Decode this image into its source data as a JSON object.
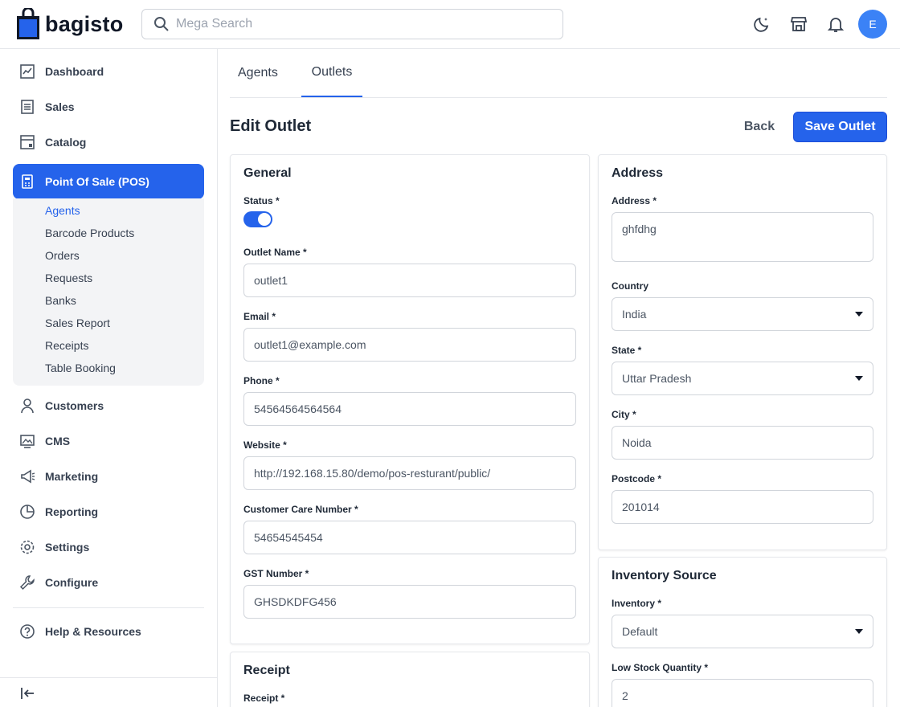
{
  "brand": {
    "name": "bagisto"
  },
  "header": {
    "search_placeholder": "Mega Search",
    "avatar_initial": "E"
  },
  "sidebar": {
    "items": [
      {
        "label": "Dashboard",
        "icon": "dashboard-icon"
      },
      {
        "label": "Sales",
        "icon": "sales-icon"
      },
      {
        "label": "Catalog",
        "icon": "catalog-icon"
      },
      {
        "label": "Point Of Sale (POS)",
        "icon": "pos-icon",
        "active": true
      },
      {
        "label": "Customers",
        "icon": "customers-icon"
      },
      {
        "label": "CMS",
        "icon": "cms-icon"
      },
      {
        "label": "Marketing",
        "icon": "marketing-icon"
      },
      {
        "label": "Reporting",
        "icon": "reporting-icon"
      },
      {
        "label": "Settings",
        "icon": "settings-icon"
      },
      {
        "label": "Configure",
        "icon": "configure-icon"
      },
      {
        "label": "Help & Resources",
        "icon": "help-icon"
      }
    ],
    "submenu": [
      "Agents",
      "Barcode Products",
      "Orders",
      "Requests",
      "Banks",
      "Sales Report",
      "Receipts",
      "Table Booking"
    ],
    "submenu_active": "Agents"
  },
  "tabs": [
    "Agents",
    "Outlets"
  ],
  "active_tab": "Outlets",
  "page": {
    "title": "Edit Outlet",
    "back_label": "Back",
    "save_label": "Save Outlet"
  },
  "general": {
    "title": "General",
    "status_label": "Status *",
    "status_on": true,
    "outlet_name_label": "Outlet Name *",
    "outlet_name": "outlet1",
    "email_label": "Email *",
    "email": "outlet1@example.com",
    "phone_label": "Phone *",
    "phone": "54564564564564",
    "website_label": "Website *",
    "website": "http://192.168.15.80/demo/pos-resturant/public/",
    "care_label": "Customer Care Number *",
    "care": "54654545454",
    "gst_label": "GST Number *",
    "gst": "GHSDKDFG456"
  },
  "receipt": {
    "title": "Receipt",
    "receipt_label": "Receipt *"
  },
  "address": {
    "title": "Address",
    "address_label": "Address *",
    "address": "ghfdhg",
    "country_label": "Country",
    "country": "India",
    "state_label": "State *",
    "state": "Uttar Pradesh",
    "city_label": "City *",
    "city": "Noida",
    "postcode_label": "Postcode *",
    "postcode": "201014"
  },
  "inventory": {
    "title": "Inventory Source",
    "inventory_label": "Inventory *",
    "inventory": "Default",
    "low_stock_label": "Low Stock Quantity *",
    "low_stock": "2"
  },
  "colors": {
    "accent": "#2563eb",
    "avatar": "#3b82f6"
  }
}
